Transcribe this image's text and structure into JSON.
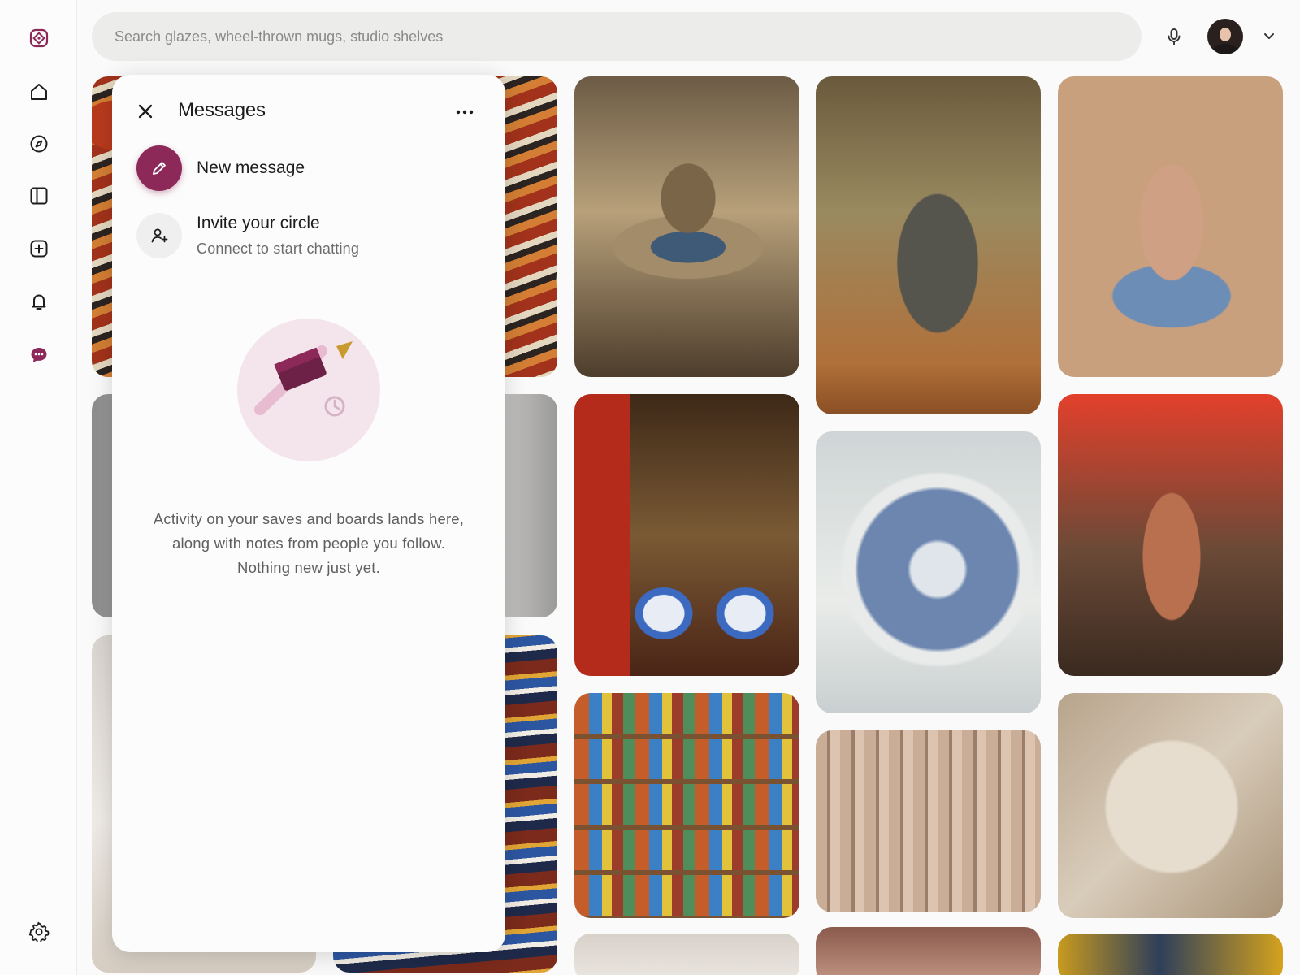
{
  "rail": {
    "items": [
      {
        "name": "logo",
        "icon": "diamond-logo-icon"
      },
      {
        "name": "home",
        "icon": "home-icon"
      },
      {
        "name": "explore",
        "icon": "compass-icon"
      },
      {
        "name": "boards",
        "icon": "boards-icon"
      },
      {
        "name": "create",
        "icon": "plus-square-icon"
      },
      {
        "name": "notifications",
        "icon": "bell-icon"
      },
      {
        "name": "messages",
        "icon": "chat-bubble-icon",
        "active": true
      },
      {
        "name": "settings",
        "icon": "gear-icon"
      }
    ],
    "accent": "#8c2958"
  },
  "search": {
    "placeholder": "Search glazes, wheel-thrown mugs, studio shelves",
    "value": ""
  },
  "header": {
    "mic_icon": "microphone-icon",
    "account_icon": "chevron-down-icon"
  },
  "messages_panel": {
    "title": "Messages",
    "new_message_label": "New message",
    "invite_title": "Invite your circle",
    "invite_subtitle": "Connect to start chatting",
    "empty_text": "Activity on your saves and boards lands here, along with notes from people you follow. Nothing new just yet."
  },
  "pins": [
    {
      "subject": "stacked patterned ceramic bowls",
      "palette": [
        "#a8361f",
        "#e9ddc8"
      ]
    },
    {
      "subject": "hands shaping clay on wheel",
      "palette": [
        "#6f5a3f",
        "#b69f7c"
      ]
    },
    {
      "subject": "dark glazed vase on wooden table",
      "palette": [
        "#4a4a45",
        "#b0703a"
      ]
    },
    {
      "subject": "potter trimming vase with blue tool",
      "palette": [
        "#c9906f",
        "#5e7fa8"
      ]
    },
    {
      "subject": "ceramic market stall",
      "palette": [
        "#9b9b9b",
        "#d8d8d8"
      ]
    },
    {
      "subject": "blue and white porcelain bowls",
      "palette": [
        "#5b3a1e",
        "#3c6ac0"
      ]
    },
    {
      "subject": "speckled blue bowl",
      "palette": [
        "#cfd5d6",
        "#5878a6"
      ]
    },
    {
      "subject": "terracotta vase on wheel",
      "palette": [
        "#b06846",
        "#e3402b"
      ]
    },
    {
      "subject": "white pottery studio",
      "palette": [
        "#d9d5d0",
        "#ece8e3"
      ]
    },
    {
      "subject": "painted market plates",
      "palette": [
        "#7b2a1b",
        "#2d56a1"
      ]
    },
    {
      "subject": "shelves of colorful pottery",
      "palette": [
        "#b68556",
        "#3b7fc4"
      ]
    },
    {
      "subject": "rows of unglazed jugs",
      "palette": [
        "#b89a84",
        "#7a6151"
      ]
    },
    {
      "subject": "clay plate with flower",
      "palette": [
        "#c9baa5",
        "#e6ddcf"
      ]
    },
    {
      "subject": "light studio detail",
      "palette": [
        "#d8d1ca",
        "#ece7e1"
      ]
    },
    {
      "subject": "terracotta pots",
      "palette": [
        "#8a5b4d",
        "#c49785"
      ]
    },
    {
      "subject": "yellow glazed wheel",
      "palette": [
        "#c89a1f",
        "#2f3f5a"
      ]
    }
  ]
}
